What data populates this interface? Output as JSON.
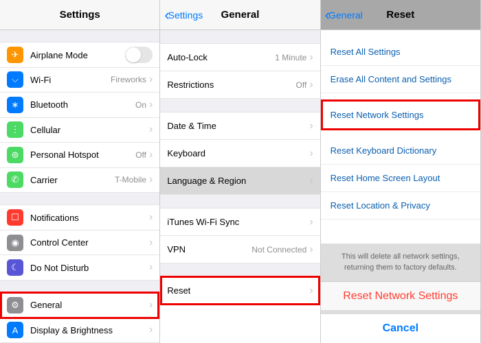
{
  "p1": {
    "title": "Settings",
    "rows": [
      {
        "icon": "✈",
        "bg": "#ff9500",
        "label": "Airplane Mode",
        "type": "toggle"
      },
      {
        "icon": "⌵",
        "bg": "#007aff",
        "label": "Wi-Fi",
        "value": "Fireworks"
      },
      {
        "icon": "∗",
        "bg": "#007aff",
        "label": "Bluetooth",
        "value": "On"
      },
      {
        "icon": "⋮",
        "bg": "#4cd964",
        "label": "Cellular"
      },
      {
        "icon": "⊚",
        "bg": "#4cd964",
        "label": "Personal Hotspot",
        "value": "Off"
      },
      {
        "icon": "✆",
        "bg": "#4cd964",
        "label": "Carrier",
        "value": "T-Mobile"
      }
    ],
    "rows2": [
      {
        "icon": "☐",
        "bg": "#ff3b30",
        "label": "Notifications"
      },
      {
        "icon": "◉",
        "bg": "#8e8e93",
        "label": "Control Center"
      },
      {
        "icon": "☾",
        "bg": "#5856d6",
        "label": "Do Not Disturb"
      }
    ],
    "rows3": [
      {
        "icon": "⚙",
        "bg": "#8e8e93",
        "label": "General",
        "hl": true
      },
      {
        "icon": "A",
        "bg": "#007aff",
        "label": "Display & Brightness"
      }
    ]
  },
  "p2": {
    "back": "Settings",
    "title": "General",
    "g1": [
      {
        "label": "Auto-Lock",
        "value": "1 Minute"
      },
      {
        "label": "Restrictions",
        "value": "Off"
      }
    ],
    "g2": [
      {
        "label": "Date & Time"
      },
      {
        "label": "Keyboard"
      },
      {
        "label": "Language & Region",
        "sel": true
      }
    ],
    "g3": [
      {
        "label": "iTunes Wi-Fi Sync"
      },
      {
        "label": "VPN",
        "value": "Not Connected"
      }
    ],
    "g4": [
      {
        "label": "Reset",
        "hl": true
      }
    ]
  },
  "p3": {
    "back": "General",
    "title": "Reset",
    "items": [
      "Reset All Settings",
      "Erase All Content and Settings",
      "",
      "Reset Network Settings",
      "",
      "Reset Keyboard Dictionary",
      "Reset Home Screen Layout",
      "Reset Location & Privacy"
    ],
    "sheetMsg": "This will delete all network settings, returning them to factory defaults.",
    "sheetAction": "Reset Network Settings",
    "sheetCancel": "Cancel"
  }
}
